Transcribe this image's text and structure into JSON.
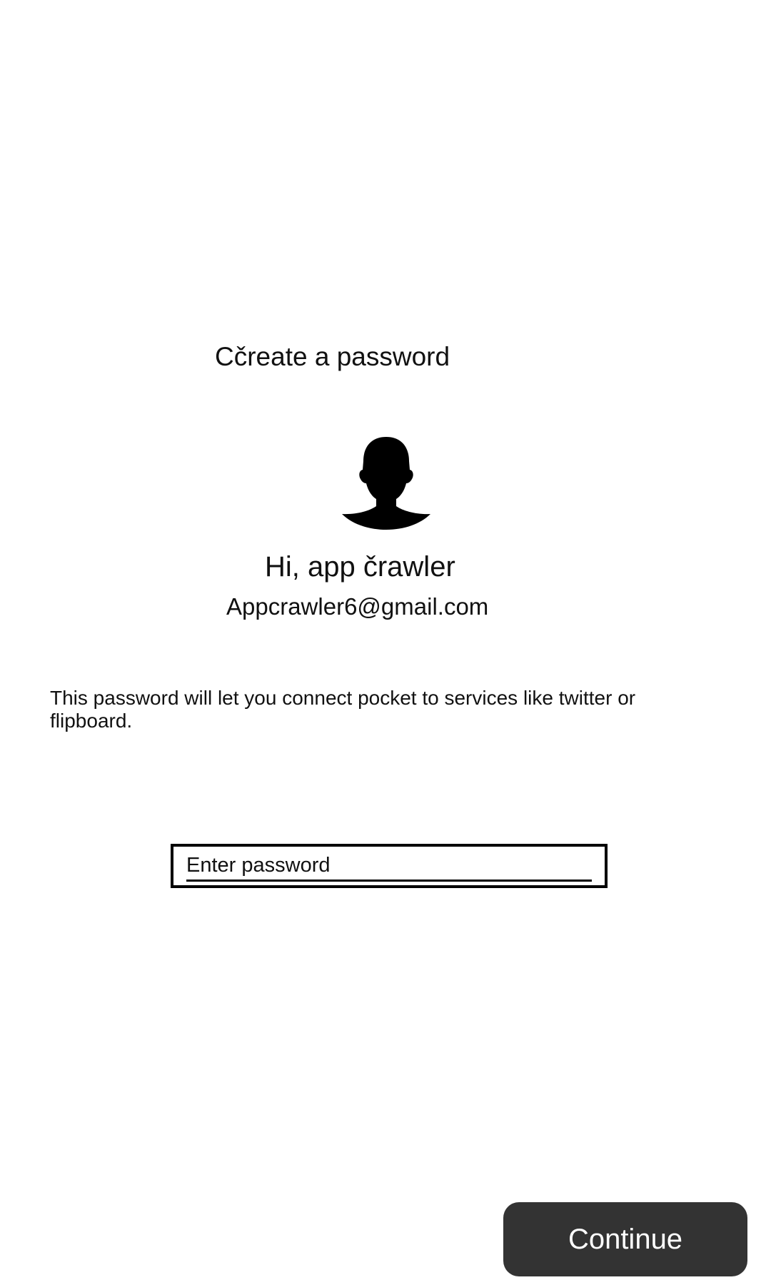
{
  "header": {
    "title": "Cčreate a password"
  },
  "profile": {
    "avatar_icon": "person-silhouette-icon",
    "greeting": "Hi, app črawler",
    "email": "Appcrawler6@gmail.com"
  },
  "description": {
    "text": "This password will let you connect pocket to services like twitter or flipboard."
  },
  "password_field": {
    "value": "",
    "placeholder": "Enter password"
  },
  "actions": {
    "continue_label": "Continue"
  },
  "colors": {
    "background": "#ffffff",
    "text": "#111111",
    "button_background": "#333333",
    "button_text": "#ffffff",
    "field_border": "#000000"
  }
}
